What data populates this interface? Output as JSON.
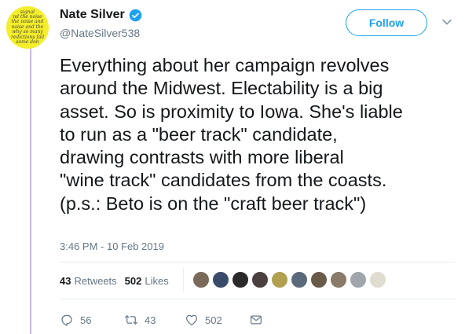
{
  "user": {
    "name": "Nate Silver",
    "handle": "@NateSilver538",
    "avatar_text_lines": [
      "signal",
      "nd the noise",
      "the noise and",
      "noise and the",
      "why so many",
      "redictions fail",
      "some don"
    ]
  },
  "follow_label": "Follow",
  "tweet": {
    "lines": [
      "Everything about her campaign revolves",
      "around the Midwest. Electability is a big",
      "asset. So is proximity to Iowa. She's liable",
      "to run as a \"beer track\" candidate,",
      "drawing contrasts with more liberal",
      "\"wine track\" candidates from the coasts.",
      "(p.s.: Beto is on the \"craft beer track\")"
    ],
    "timestamp": "3:46 PM - 10 Feb 2019"
  },
  "stats": {
    "retweets_count": "43",
    "retweets_label": "Retweets",
    "likes_count": "502",
    "likes_label": "Likes"
  },
  "likers": [
    {
      "color": "#7a6a5a"
    },
    {
      "color": "#3a4a6a"
    },
    {
      "color": "#2a2a2a"
    },
    {
      "color": "#4a4040"
    },
    {
      "color": "#b0a050"
    },
    {
      "color": "#5a6a7a"
    },
    {
      "color": "#6a5a4a"
    },
    {
      "color": "#8a7a6a"
    },
    {
      "color": "#a0a6ab"
    },
    {
      "color": "#e0dcd0"
    }
  ],
  "actions": {
    "reply_count": "56",
    "retweet_count": "43",
    "like_count": "502"
  },
  "colors": {
    "accent": "#1da1f2",
    "muted": "#657786",
    "thread_line": "#c9b8e0",
    "avatar_bg": "#f5ee2a"
  }
}
